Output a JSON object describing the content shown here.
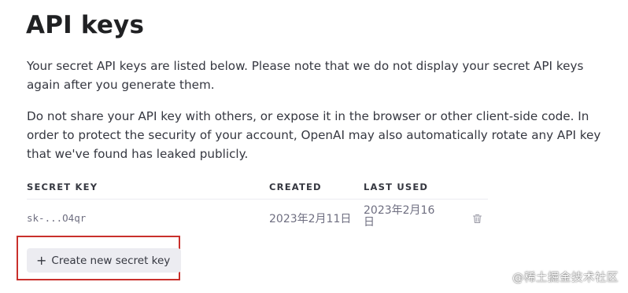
{
  "page": {
    "title": "API keys",
    "description_1": "Your secret API keys are listed below. Please note that we do not display your secret API keys again after you generate them.",
    "description_2": "Do not share your API key with others, or expose it in the browser or other client-side code. In order to protect the security of your account, OpenAI may also automatically rotate any API key that we've found has leaked publicly."
  },
  "table": {
    "headers": {
      "secret_key": "SECRET KEY",
      "created": "CREATED",
      "last_used": "LAST USED"
    },
    "rows": [
      {
        "secret_key": "sk-...O4qr",
        "created": "2023年2月11日",
        "last_used": "2023年2月16日",
        "delete_icon": "trash-icon"
      }
    ]
  },
  "actions": {
    "create_icon": "plus-icon",
    "create_symbol": "+",
    "create_label": "Create new secret key"
  },
  "watermark": {
    "text": "@稀土掘金技术社区"
  },
  "colors": {
    "highlight_border": "#c9302c",
    "button_bg": "#ececf1",
    "text_primary": "#353740"
  }
}
